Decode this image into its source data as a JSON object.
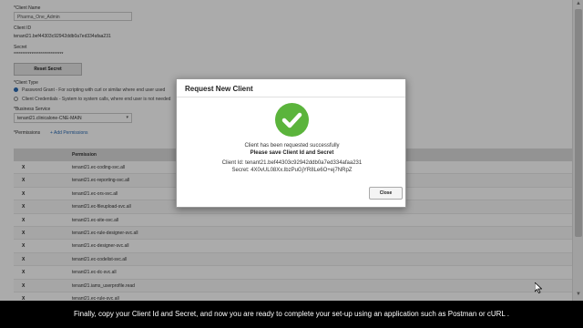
{
  "form": {
    "client_name_label": "*Client Name",
    "client_name_value": "Pharma_One_Admin",
    "client_id_label": "Client ID",
    "client_id_value": "tenant21.bef44303c92942ddb0a7ed334afaa231",
    "secret_label": "Secret",
    "secret_value": "****************************",
    "reset_secret_button": "Reset Secret",
    "client_type_label": "*Client Type",
    "client_type_options": [
      {
        "label": "Password Grant - For scripting with curl or similar where end user used"
      },
      {
        "label": "Client Credentials - System to system calls, where end user is not needed"
      }
    ],
    "business_service_label": "*Business Service",
    "business_service_value": "tenant21.clinicalone-CNE-MAIN",
    "permissions_label": "*Permissions",
    "add_permissions_link": "+ Add Permissions"
  },
  "table": {
    "header": "Permission",
    "remove_glyph": "X",
    "rows": [
      "tenant21.ec-coding-svc.all",
      "tenant21.ec-reporting-svc.all",
      "tenant21.ec-ors-svc.all",
      "tenant21.ec-fileupload-svc.all",
      "tenant21.ec-site-svc.all",
      "tenant21.ec-rule-designer-svc.all",
      "tenant21.ec-designer-svc.all",
      "tenant21.ec-codelist-svc.all",
      "tenant21.ec-dc-svc.all",
      "tenant21.iams_userprofile.read",
      "tenant21.ec-rule-svc.all"
    ]
  },
  "modal": {
    "title": "Request New Client",
    "icon": "check-circle-icon",
    "line1": "Client has been requested successfully",
    "line2": "Please save Client Id and Secret",
    "client_id_line": "Client Id: tenant21.bef44303c92942ddb0a7ed334afaa231",
    "secret_line": "Secret: 4X0vUL08Xx.lbzPuGjYR8Le6O+ej7NRpZ",
    "close_button": "Close"
  },
  "caption": "Finally, copy your Client Id and Secret, and now you are ready to complete your set-up using an application such as Postman or cURL .",
  "colors": {
    "accent": "#2a6bb3",
    "success": "#5bb43c",
    "caption_bg": "#000000"
  }
}
